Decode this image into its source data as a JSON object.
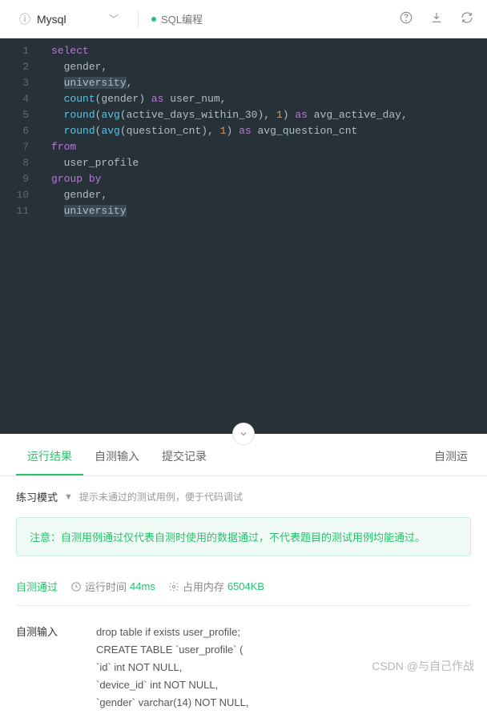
{
  "topbar": {
    "language": "Mysql",
    "tab_title": "SQL编程"
  },
  "code_lines": [
    "select",
    "  gender,",
    "  university,",
    "  count(gender) as user_num,",
    "  round(avg(active_days_within_30), 1) as avg_active_day,",
    "  round(avg(question_cnt), 1) as avg_question_cnt",
    "from",
    "  user_profile",
    "group by",
    "  gender,",
    "  university"
  ],
  "tabs": {
    "result": "运行结果",
    "self_input": "自测输入",
    "submit_history": "提交记录",
    "run_self": "自测运"
  },
  "mode": {
    "label": "练习模式",
    "hint": "提示未通过的测试用例，便于代码调试"
  },
  "notice": "注意：自测用例通过仅代表自测时使用的数据通过，不代表题目的测试用例均能通过。",
  "pass": {
    "label": "自测通过",
    "time_label": "运行时间",
    "time_value": "44ms",
    "mem_label": "占用内存",
    "mem_value": "6504KB"
  },
  "self_input": {
    "label": "自测输入",
    "lines": [
      "drop table if exists user_profile;",
      "CREATE TABLE `user_profile` (",
      "`id` int NOT NULL,",
      "`device_id` int NOT NULL,",
      "`gender` varchar(14) NOT NULL,"
    ]
  },
  "watermark": "CSDN @与自己作战"
}
